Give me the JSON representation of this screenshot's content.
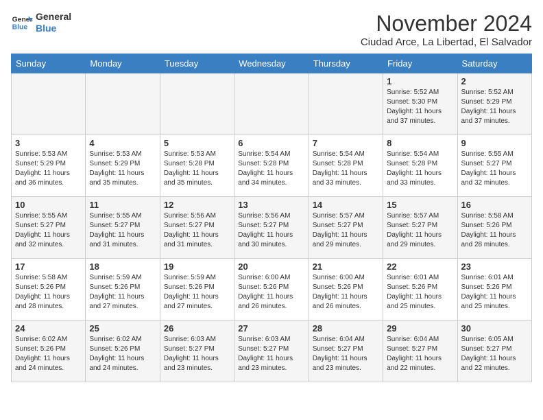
{
  "logo": {
    "line1": "General",
    "line2": "Blue"
  },
  "header": {
    "month": "November 2024",
    "location": "Ciudad Arce, La Libertad, El Salvador"
  },
  "weekdays": [
    "Sunday",
    "Monday",
    "Tuesday",
    "Wednesday",
    "Thursday",
    "Friday",
    "Saturday"
  ],
  "weeks": [
    [
      {
        "day": "",
        "info": ""
      },
      {
        "day": "",
        "info": ""
      },
      {
        "day": "",
        "info": ""
      },
      {
        "day": "",
        "info": ""
      },
      {
        "day": "",
        "info": ""
      },
      {
        "day": "1",
        "info": "Sunrise: 5:52 AM\nSunset: 5:30 PM\nDaylight: 11 hours and 37 minutes."
      },
      {
        "day": "2",
        "info": "Sunrise: 5:52 AM\nSunset: 5:29 PM\nDaylight: 11 hours and 37 minutes."
      }
    ],
    [
      {
        "day": "3",
        "info": "Sunrise: 5:53 AM\nSunset: 5:29 PM\nDaylight: 11 hours and 36 minutes."
      },
      {
        "day": "4",
        "info": "Sunrise: 5:53 AM\nSunset: 5:29 PM\nDaylight: 11 hours and 35 minutes."
      },
      {
        "day": "5",
        "info": "Sunrise: 5:53 AM\nSunset: 5:28 PM\nDaylight: 11 hours and 35 minutes."
      },
      {
        "day": "6",
        "info": "Sunrise: 5:54 AM\nSunset: 5:28 PM\nDaylight: 11 hours and 34 minutes."
      },
      {
        "day": "7",
        "info": "Sunrise: 5:54 AM\nSunset: 5:28 PM\nDaylight: 11 hours and 33 minutes."
      },
      {
        "day": "8",
        "info": "Sunrise: 5:54 AM\nSunset: 5:28 PM\nDaylight: 11 hours and 33 minutes."
      },
      {
        "day": "9",
        "info": "Sunrise: 5:55 AM\nSunset: 5:27 PM\nDaylight: 11 hours and 32 minutes."
      }
    ],
    [
      {
        "day": "10",
        "info": "Sunrise: 5:55 AM\nSunset: 5:27 PM\nDaylight: 11 hours and 32 minutes."
      },
      {
        "day": "11",
        "info": "Sunrise: 5:55 AM\nSunset: 5:27 PM\nDaylight: 11 hours and 31 minutes."
      },
      {
        "day": "12",
        "info": "Sunrise: 5:56 AM\nSunset: 5:27 PM\nDaylight: 11 hours and 31 minutes."
      },
      {
        "day": "13",
        "info": "Sunrise: 5:56 AM\nSunset: 5:27 PM\nDaylight: 11 hours and 30 minutes."
      },
      {
        "day": "14",
        "info": "Sunrise: 5:57 AM\nSunset: 5:27 PM\nDaylight: 11 hours and 29 minutes."
      },
      {
        "day": "15",
        "info": "Sunrise: 5:57 AM\nSunset: 5:27 PM\nDaylight: 11 hours and 29 minutes."
      },
      {
        "day": "16",
        "info": "Sunrise: 5:58 AM\nSunset: 5:26 PM\nDaylight: 11 hours and 28 minutes."
      }
    ],
    [
      {
        "day": "17",
        "info": "Sunrise: 5:58 AM\nSunset: 5:26 PM\nDaylight: 11 hours and 28 minutes."
      },
      {
        "day": "18",
        "info": "Sunrise: 5:59 AM\nSunset: 5:26 PM\nDaylight: 11 hours and 27 minutes."
      },
      {
        "day": "19",
        "info": "Sunrise: 5:59 AM\nSunset: 5:26 PM\nDaylight: 11 hours and 27 minutes."
      },
      {
        "day": "20",
        "info": "Sunrise: 6:00 AM\nSunset: 5:26 PM\nDaylight: 11 hours and 26 minutes."
      },
      {
        "day": "21",
        "info": "Sunrise: 6:00 AM\nSunset: 5:26 PM\nDaylight: 11 hours and 26 minutes."
      },
      {
        "day": "22",
        "info": "Sunrise: 6:01 AM\nSunset: 5:26 PM\nDaylight: 11 hours and 25 minutes."
      },
      {
        "day": "23",
        "info": "Sunrise: 6:01 AM\nSunset: 5:26 PM\nDaylight: 11 hours and 25 minutes."
      }
    ],
    [
      {
        "day": "24",
        "info": "Sunrise: 6:02 AM\nSunset: 5:26 PM\nDaylight: 11 hours and 24 minutes."
      },
      {
        "day": "25",
        "info": "Sunrise: 6:02 AM\nSunset: 5:26 PM\nDaylight: 11 hours and 24 minutes."
      },
      {
        "day": "26",
        "info": "Sunrise: 6:03 AM\nSunset: 5:27 PM\nDaylight: 11 hours and 23 minutes."
      },
      {
        "day": "27",
        "info": "Sunrise: 6:03 AM\nSunset: 5:27 PM\nDaylight: 11 hours and 23 minutes."
      },
      {
        "day": "28",
        "info": "Sunrise: 6:04 AM\nSunset: 5:27 PM\nDaylight: 11 hours and 23 minutes."
      },
      {
        "day": "29",
        "info": "Sunrise: 6:04 AM\nSunset: 5:27 PM\nDaylight: 11 hours and 22 minutes."
      },
      {
        "day": "30",
        "info": "Sunrise: 6:05 AM\nSunset: 5:27 PM\nDaylight: 11 hours and 22 minutes."
      }
    ]
  ]
}
